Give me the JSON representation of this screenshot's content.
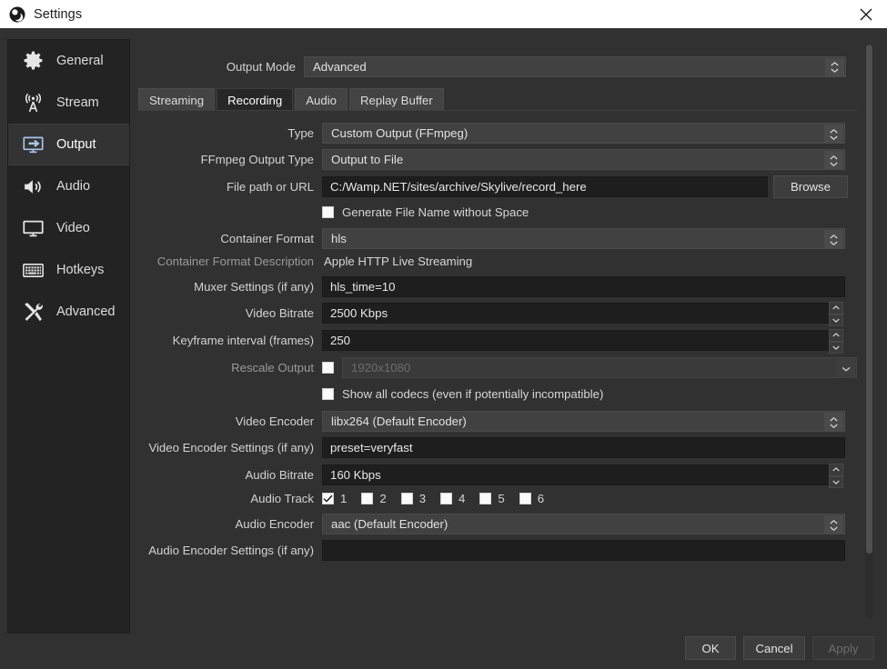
{
  "window": {
    "title": "Settings",
    "app_icon": "obs-logo-icon",
    "close_icon": "close-icon"
  },
  "sidebar": {
    "items": [
      {
        "label": "General",
        "icon": "gear-icon",
        "selected": false
      },
      {
        "label": "Stream",
        "icon": "broadcast-icon",
        "selected": false
      },
      {
        "label": "Output",
        "icon": "output-icon",
        "selected": true
      },
      {
        "label": "Audio",
        "icon": "speaker-icon",
        "selected": false
      },
      {
        "label": "Video",
        "icon": "monitor-icon",
        "selected": false
      },
      {
        "label": "Hotkeys",
        "icon": "keyboard-icon",
        "selected": false
      },
      {
        "label": "Advanced",
        "icon": "tools-icon",
        "selected": false
      }
    ]
  },
  "output_mode": {
    "label": "Output Mode",
    "value": "Advanced"
  },
  "tabs": [
    {
      "label": "Streaming",
      "active": false
    },
    {
      "label": "Recording",
      "active": true
    },
    {
      "label": "Audio",
      "active": false
    },
    {
      "label": "Replay Buffer",
      "active": false
    }
  ],
  "form": {
    "type": {
      "label": "Type",
      "value": "Custom Output (FFmpeg)"
    },
    "ffmpeg_output_type": {
      "label": "FFmpeg Output Type",
      "value": "Output to File"
    },
    "file_path": {
      "label": "File path or URL",
      "value": "C:/Wamp.NET/sites/archive/Skylive/record_here",
      "browse_label": "Browse"
    },
    "generate_no_space": {
      "label": "Generate File Name without Space",
      "checked": false
    },
    "container_format": {
      "label": "Container Format",
      "value": "hls"
    },
    "container_format_description": {
      "label": "Container Format Description",
      "value": "Apple HTTP Live Streaming"
    },
    "muxer_settings": {
      "label": "Muxer Settings (if any)",
      "value": "hls_time=10"
    },
    "video_bitrate": {
      "label": "Video Bitrate",
      "value": "2500 Kbps"
    },
    "keyframe_interval": {
      "label": "Keyframe interval (frames)",
      "value": "250"
    },
    "rescale_output": {
      "label": "Rescale Output",
      "checked": false,
      "value": "1920x1080",
      "enabled": false
    },
    "show_all_codecs": {
      "label": "Show all codecs (even if potentially incompatible)",
      "checked": false
    },
    "video_encoder": {
      "label": "Video Encoder",
      "value": "libx264 (Default Encoder)"
    },
    "video_encoder_settings": {
      "label": "Video Encoder Settings (if any)",
      "value": "preset=veryfast"
    },
    "audio_bitrate": {
      "label": "Audio Bitrate",
      "value": "160 Kbps"
    },
    "audio_track": {
      "label": "Audio Track",
      "tracks": [
        {
          "num": "1",
          "checked": true
        },
        {
          "num": "2",
          "checked": false
        },
        {
          "num": "3",
          "checked": false
        },
        {
          "num": "4",
          "checked": false
        },
        {
          "num": "5",
          "checked": false
        },
        {
          "num": "6",
          "checked": false
        }
      ]
    },
    "audio_encoder": {
      "label": "Audio Encoder",
      "value": "aac (Default Encoder)"
    },
    "audio_encoder_settings": {
      "label": "Audio Encoder Settings (if any)",
      "value": ""
    }
  },
  "footer": {
    "ok": "OK",
    "cancel": "Cancel",
    "apply": "Apply",
    "apply_enabled": false
  },
  "colors": {
    "window_bg": "#313131",
    "sidebar_bg": "#232323",
    "titlebar_bg": "#ffffff",
    "input_bg": "#1e1e1e",
    "combo_bg": "#414141",
    "accent": "#a9c6e8"
  }
}
